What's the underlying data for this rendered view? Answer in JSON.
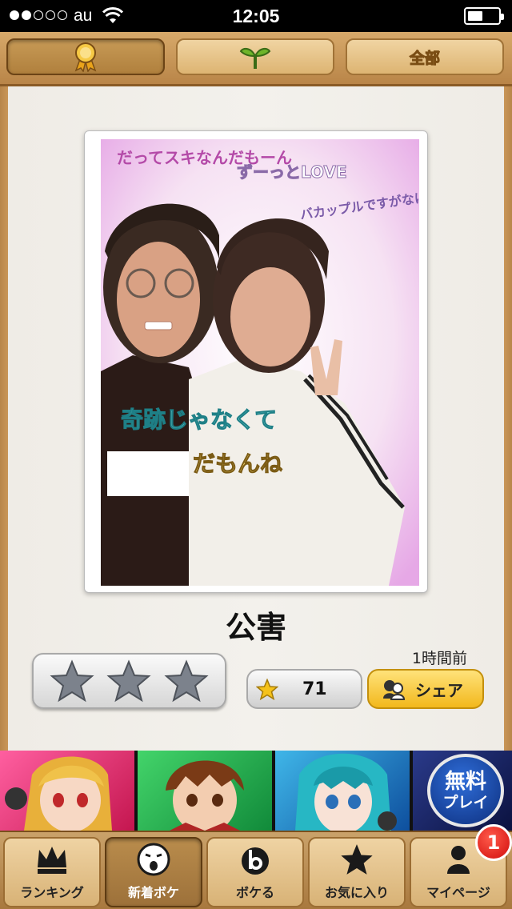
{
  "status_bar": {
    "carrier": "au",
    "time": "12:05"
  },
  "filter_tabs": [
    {
      "name": "hit",
      "icon": "hit-ribbon-icon",
      "label": ""
    },
    {
      "name": "new",
      "icon": "sprout-icon",
      "label": ""
    },
    {
      "name": "all",
      "icon": "",
      "label": "全部"
    }
  ],
  "post": {
    "title": "公害",
    "time_ago": "1時間前",
    "star_count": "71",
    "share_label": "シェア",
    "photo_texts": {
      "top_left": "だってスキなんだもーん",
      "top_right": "ずーっとLOVE",
      "right": "バカップルですがなにか?",
      "bottom_1": "奇跡じゃなくて",
      "bottom_2": "だもんね"
    }
  },
  "banner": {
    "free_line1": "無料",
    "free_line2": "プレイ"
  },
  "tabbar": {
    "items": [
      {
        "label": "ランキング",
        "icon": "crown-icon"
      },
      {
        "label": "新着ボケ",
        "icon": "face-icon"
      },
      {
        "label": "ボケる",
        "icon": "boke-icon"
      },
      {
        "label": "お気に入り",
        "icon": "star-icon"
      },
      {
        "label": "マイページ",
        "icon": "person-icon"
      }
    ],
    "badge": "1"
  },
  "colors": {
    "wood": "#c99658",
    "gold": "#f3c24a",
    "share": "#f2b81c",
    "badge": "#d10d0d"
  }
}
